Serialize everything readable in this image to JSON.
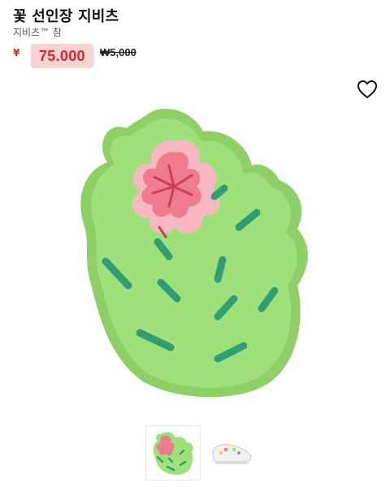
{
  "product": {
    "title": "꽃 선인장 지비츠",
    "subtitle": "지비츠™ 참",
    "currency_stub": "¥",
    "sale_price": "75.000",
    "original_price": "₩5,000"
  },
  "icons": {
    "favorite": "heart-outline-icon"
  },
  "colors": {
    "sale_text": "#e0222c",
    "sale_badge": "#fbd3d3",
    "cactus_body": "#95dc6c",
    "cactus_spine": "#2f9e74",
    "flower_pink": "#f07b8c"
  },
  "gallery": {
    "thumbnails": [
      {
        "name": "cactus-charm",
        "active": true
      },
      {
        "name": "white-clog-with-charms",
        "active": false
      }
    ]
  }
}
